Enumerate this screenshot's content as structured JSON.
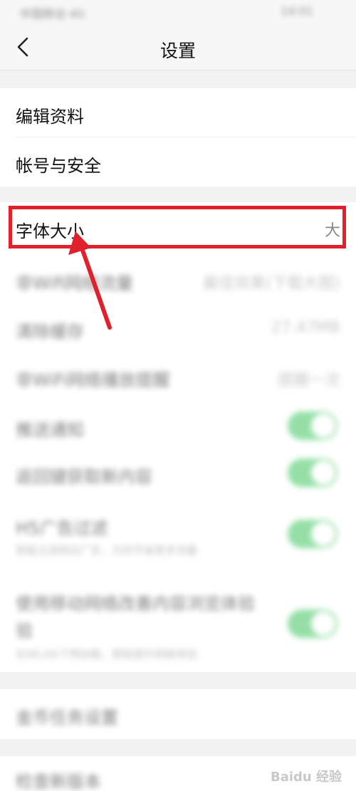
{
  "status_bar": {
    "left": "中国移动 4G",
    "right": "14:01"
  },
  "navbar": {
    "title": "设置"
  },
  "account_group": [
    {
      "label": "编辑资料"
    },
    {
      "label": "帐号与安全"
    }
  ],
  "display_group": {
    "font_size": {
      "label": "字体大小",
      "value": "大"
    },
    "rows": [
      {
        "label": "非Wifi网络流量",
        "value": "最佳效果(下载大图)"
      },
      {
        "label": "清除缓存",
        "value": "27.47MB"
      },
      {
        "label": "非WiFi网络播放提醒",
        "value": "提醒一次"
      }
    ],
    "toggles": [
      {
        "label": "推送通知",
        "sub": "",
        "on": true
      },
      {
        "label": "返回键获取新内容",
        "sub": "",
        "on": true
      },
      {
        "label": "H5广告过滤",
        "sub": "智能过滤网站广告，为你节省更多流量",
        "on": true
      },
      {
        "label": "使用移动网络改善内容浏览体验",
        "label2": "验",
        "sub": "在WLAN下预加载，帮助提升网络体验",
        "on": true
      }
    ]
  },
  "task_group": {
    "label": "金币任务设置"
  },
  "update_group": {
    "label": "检查新版本"
  },
  "watermark": "Baidu 经验",
  "colors": {
    "toggle_on": "#3fc55f",
    "highlight": "#e0202a"
  }
}
